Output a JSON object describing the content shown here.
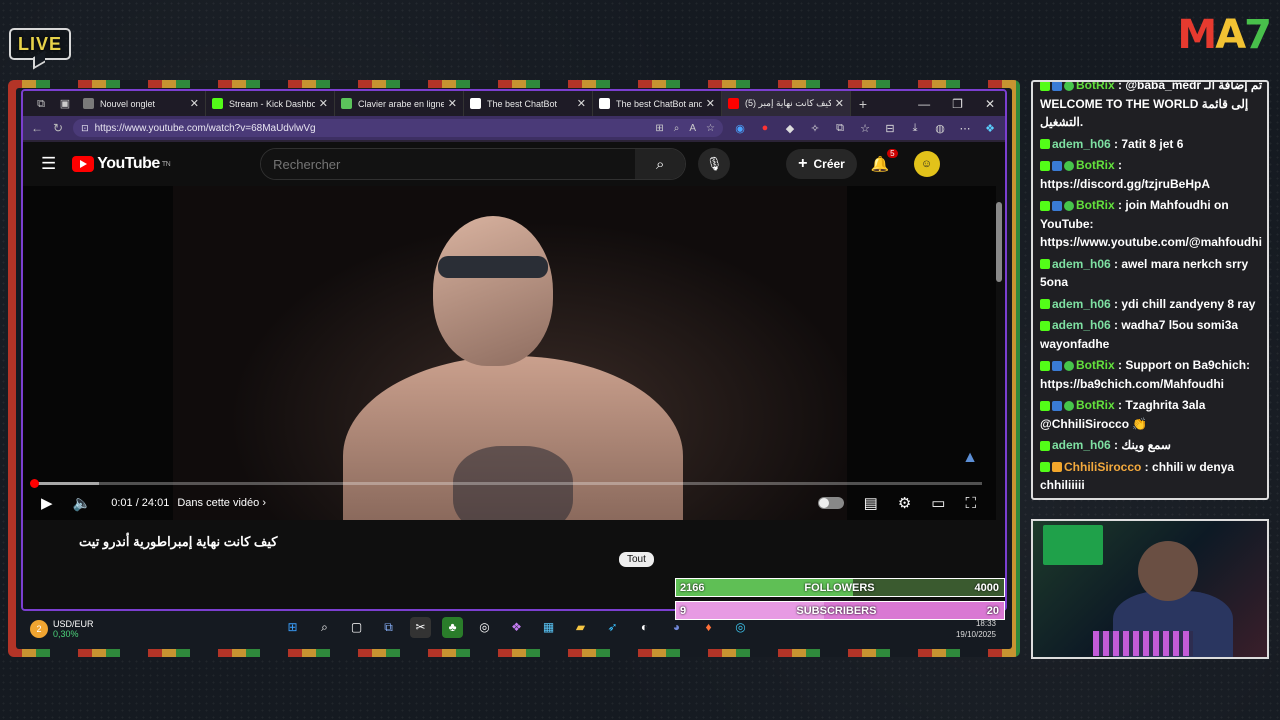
{
  "overlay": {
    "live_label": "LIVE",
    "logo": {
      "m": "M",
      "a": "A",
      "s": "7"
    }
  },
  "browser": {
    "tabs": [
      {
        "title": "Nouvel onglet",
        "icon": "new-tab-icon",
        "color": "#7a7a7a"
      },
      {
        "title": "Stream - Kick Dashbo",
        "icon": "kick-icon",
        "color": "#53fc18"
      },
      {
        "title": "Clavier arabe en ligne",
        "icon": "keyboard-icon",
        "color": "#5bc45b"
      },
      {
        "title": "The best ChatBot",
        "icon": "chatbot-icon",
        "color": "#ffffff"
      },
      {
        "title": "The best ChatBot and",
        "icon": "chatbot-icon",
        "color": "#ffffff"
      },
      {
        "title": "(5) كيف كانت نهاية إمبر",
        "icon": "youtube-icon",
        "color": "#ff0000"
      }
    ],
    "url": "https://www.youtube.com/watch?v=68MaUdvlwVg"
  },
  "youtube": {
    "logo_text": "YouTube",
    "logo_sup": "TN",
    "search_placeholder": "Rechercher",
    "create_label": "Créer",
    "notif_count": "5",
    "time": "0:01 / 24:01",
    "chapter": "Dans cette vidéo",
    "progress_fraction": 0.0,
    "video_title": "كيف كانت نهاية إمبراطورية أندرو تيت",
    "chip": "Tout"
  },
  "goals": {
    "followers": {
      "current": "2166",
      "label": "FOLLOWERS",
      "target": "4000",
      "fraction": 0.54
    },
    "subscribers": {
      "current": "9",
      "label": "SUBSCRIBERS",
      "target": "20",
      "fraction": 0.45
    }
  },
  "taskbar": {
    "widget_badge": "2",
    "widget_name": "USD/EUR",
    "widget_value": "0,30%",
    "time": "18:33",
    "date": "19/10/2025"
  },
  "chat": [
    {
      "user": "BotRix",
      "text": "@baba_medr تم إضافة الـ WELCOME TO THE WORLD إلى قائمة التشغيل.",
      "badges": [
        "kick",
        "bot",
        "ver"
      ],
      "cls": "u-bot"
    },
    {
      "user": "adem_h06",
      "text": "7atit 8 jet 6",
      "badges": [
        "kick"
      ],
      "cls": "u-adem"
    },
    {
      "user": "BotRix",
      "text": "https://discord.gg/tzjruBeHpA",
      "badges": [
        "kick",
        "bot",
        "ver"
      ],
      "cls": "u-bot"
    },
    {
      "user": "BotRix",
      "text": "join Mahfoudhi on YouTube: https://www.youtube.com/@mahfoudhi",
      "badges": [
        "kick",
        "bot",
        "ver"
      ],
      "cls": "u-bot"
    },
    {
      "user": "adem_h06",
      "text": "awel mara nerkch srry 5ona",
      "badges": [
        "kick"
      ],
      "cls": "u-adem"
    },
    {
      "user": "adem_h06",
      "text": "ydi chill zandyeny 8 ray",
      "badges": [
        "kick"
      ],
      "cls": "u-adem"
    },
    {
      "user": "adem_h06",
      "text": "wadha7 l5ou somi3a wayonfadhe",
      "badges": [
        "kick"
      ],
      "cls": "u-adem"
    },
    {
      "user": "BotRix",
      "text": "Support on Ba9chich: https://ba9chich.com/Mahfoudhi",
      "badges": [
        "kick",
        "bot",
        "ver"
      ],
      "cls": "u-bot"
    },
    {
      "user": "BotRix",
      "text": "Tzaghrita 3ala @ChhiliSirocco 👏",
      "badges": [
        "kick",
        "bot",
        "ver"
      ],
      "cls": "u-bot"
    },
    {
      "user": "adem_h06",
      "text": "سمع وينك",
      "badges": [
        "kick"
      ],
      "cls": "u-adem"
    },
    {
      "user": "ChhiliSirocco",
      "text": "chhili w denya chhiliiiii",
      "badges": [
        "kick",
        "sub"
      ],
      "cls": "u-chh"
    }
  ]
}
